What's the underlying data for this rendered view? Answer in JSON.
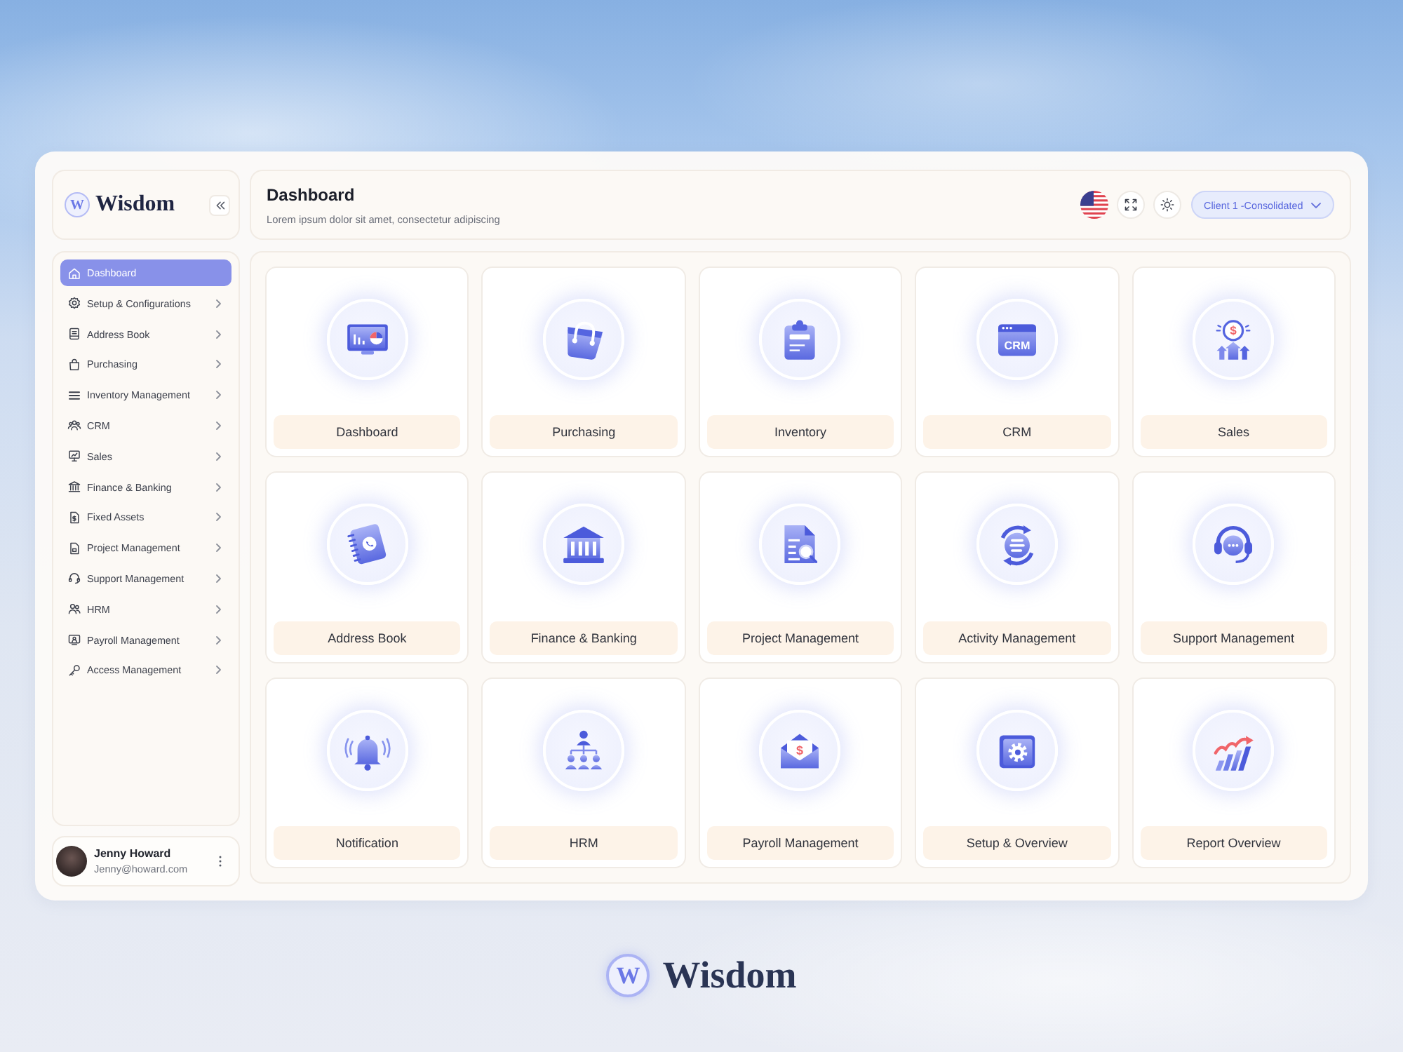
{
  "sidebar": {
    "logo": {
      "mark": "W",
      "name": "Wisdom"
    },
    "nav": [
      {
        "label": "Dashboard",
        "selected": true,
        "has_submenu": false
      },
      {
        "label": "Setup & Configurations",
        "selected": false,
        "has_submenu": true
      },
      {
        "label": "Address Book",
        "selected": false,
        "has_submenu": true
      },
      {
        "label": "Purchasing",
        "selected": false,
        "has_submenu": true
      },
      {
        "label": "Inventory Management",
        "selected": false,
        "has_submenu": true
      },
      {
        "label": "CRM",
        "selected": false,
        "has_submenu": true
      },
      {
        "label": "Sales",
        "selected": false,
        "has_submenu": true
      },
      {
        "label": "Finance & Banking",
        "selected": false,
        "has_submenu": true
      },
      {
        "label": "Fixed Assets",
        "selected": false,
        "has_submenu": true
      },
      {
        "label": "Project Management",
        "selected": false,
        "has_submenu": true
      },
      {
        "label": "Support Management",
        "selected": false,
        "has_submenu": true
      },
      {
        "label": "HRM",
        "selected": false,
        "has_submenu": true
      },
      {
        "label": "Payroll Management",
        "selected": false,
        "has_submenu": true
      },
      {
        "label": "Access Management",
        "selected": false,
        "has_submenu": true
      }
    ],
    "user": {
      "name": "Jenny Howard",
      "email": "Jenny@howard.com"
    }
  },
  "header": {
    "title": "Dashboard",
    "subtitle": "Lorem ipsum dolor sit amet, consectetur adipiscing",
    "client_select": "Client 1 -Consolidated"
  },
  "modules": [
    {
      "label": "Dashboard"
    },
    {
      "label": "Purchasing"
    },
    {
      "label": "Inventory"
    },
    {
      "label": "CRM",
      "icon_text": "CRM"
    },
    {
      "label": "Sales",
      "icon_text": "$"
    },
    {
      "label": "Address Book"
    },
    {
      "label": "Finance & Banking"
    },
    {
      "label": "Project Management"
    },
    {
      "label": "Activity Management"
    },
    {
      "label": "Support Management"
    },
    {
      "label": "Notification"
    },
    {
      "label": "HRM"
    },
    {
      "label": "Payroll Management",
      "icon_text": "$"
    },
    {
      "label": "Setup & Overview"
    },
    {
      "label": "Report Overview"
    }
  ],
  "footer_logo": {
    "mark": "W",
    "name": "Wisdom"
  }
}
